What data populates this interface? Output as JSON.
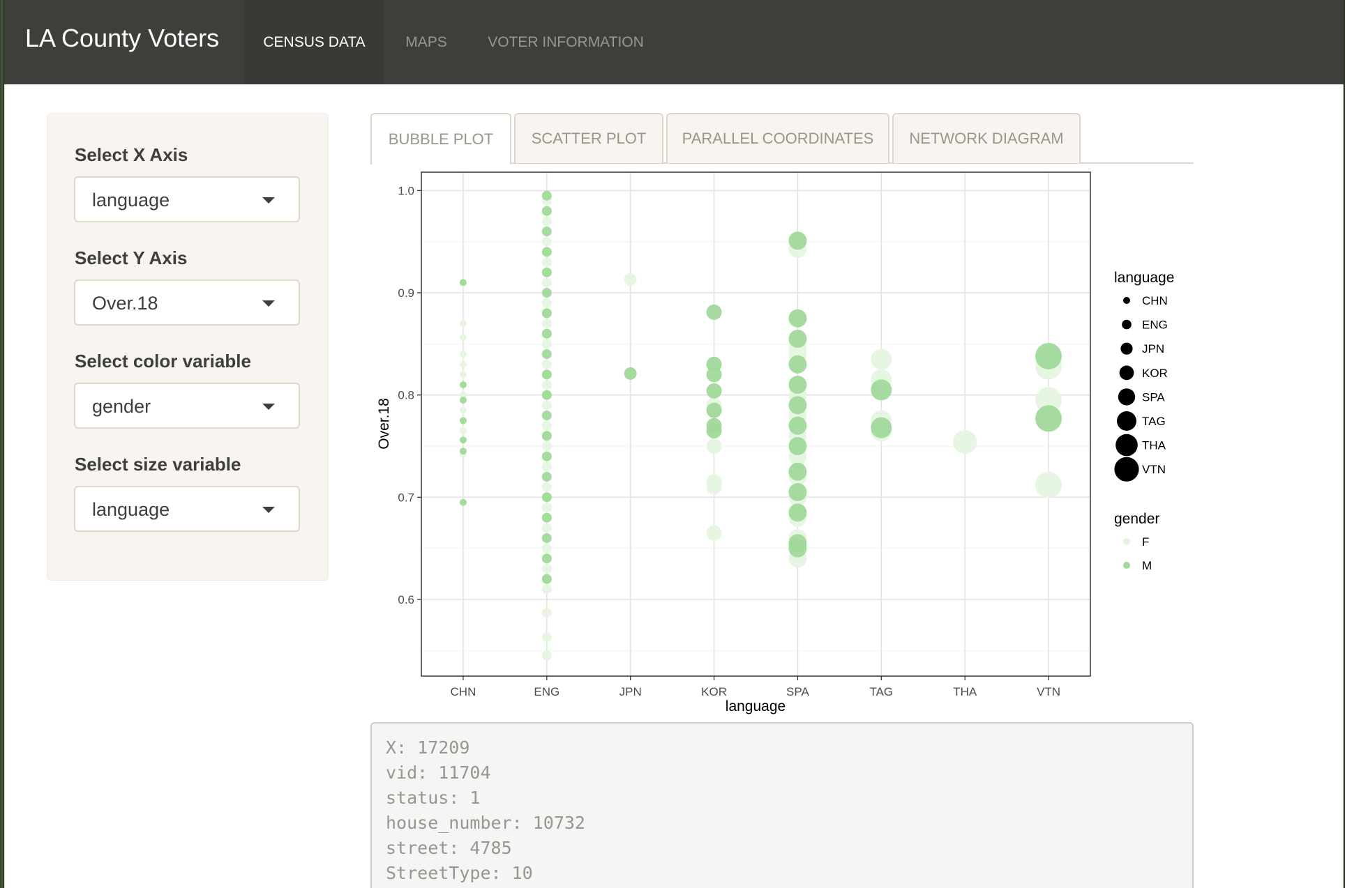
{
  "navbar": {
    "brand": "LA County Voters",
    "items": [
      {
        "label": "CENSUS DATA",
        "active": true
      },
      {
        "label": "MAPS",
        "active": false
      },
      {
        "label": "VOTER INFORMATION",
        "active": false
      }
    ]
  },
  "sidebar": {
    "fields": [
      {
        "label": "Select X Axis",
        "value": "language"
      },
      {
        "label": "Select Y Axis",
        "value": "Over.18"
      },
      {
        "label": "Select color variable",
        "value": "gender"
      },
      {
        "label": "Select size variable",
        "value": "language"
      }
    ]
  },
  "tabs": [
    {
      "label": "BUBBLE PLOT",
      "active": true
    },
    {
      "label": "SCATTER PLOT",
      "active": false
    },
    {
      "label": "PARALLEL COORDINATES",
      "active": false
    },
    {
      "label": "NETWORK DIAGRAM",
      "active": false
    }
  ],
  "chart_data": {
    "type": "scatter",
    "xlabel": "language",
    "ylabel": "Over.18",
    "categories": [
      "CHN",
      "ENG",
      "JPN",
      "KOR",
      "SPA",
      "TAG",
      "THA",
      "VTN"
    ],
    "ylim": [
      0.525,
      1.018
    ],
    "yticks": [
      0.6,
      0.7,
      0.8,
      0.9,
      1.0
    ],
    "ytick_labels": [
      "0.6",
      "0.7",
      "0.8",
      "0.9",
      "1.0"
    ],
    "grid": true,
    "colors": {
      "F": "#e5f5e0",
      "M": "#a1d99b"
    },
    "size_legend": {
      "title": "language",
      "entries": [
        "CHN",
        "ENG",
        "JPN",
        "KOR",
        "SPA",
        "TAG",
        "THA",
        "VTN"
      ]
    },
    "color_legend": {
      "title": "gender",
      "entries": [
        "F",
        "M"
      ]
    },
    "series": [
      {
        "name": "F",
        "points": [
          [
            "CHN",
            0.87
          ],
          [
            "CHN",
            0.856
          ],
          [
            "CHN",
            0.84
          ],
          [
            "CHN",
            0.83
          ],
          [
            "CHN",
            0.82
          ],
          [
            "CHN",
            0.8
          ],
          [
            "CHN",
            0.785
          ],
          [
            "CHN",
            0.765
          ],
          [
            "CHN",
            0.742
          ],
          [
            "ENG",
            0.99
          ],
          [
            "ENG",
            0.97
          ],
          [
            "ENG",
            0.95
          ],
          [
            "ENG",
            0.93
          ],
          [
            "ENG",
            0.91
          ],
          [
            "ENG",
            0.89
          ],
          [
            "ENG",
            0.87
          ],
          [
            "ENG",
            0.85
          ],
          [
            "ENG",
            0.83
          ],
          [
            "ENG",
            0.81
          ],
          [
            "ENG",
            0.79
          ],
          [
            "ENG",
            0.77
          ],
          [
            "ENG",
            0.75
          ],
          [
            "ENG",
            0.73
          ],
          [
            "ENG",
            0.71
          ],
          [
            "ENG",
            0.69
          ],
          [
            "ENG",
            0.67
          ],
          [
            "ENG",
            0.65
          ],
          [
            "ENG",
            0.63
          ],
          [
            "ENG",
            0.61
          ],
          [
            "ENG",
            0.587
          ],
          [
            "ENG",
            0.563
          ],
          [
            "ENG",
            0.545
          ],
          [
            "JPN",
            0.913
          ],
          [
            "KOR",
            0.79
          ],
          [
            "KOR",
            0.75
          ],
          [
            "KOR",
            0.715
          ],
          [
            "KOR",
            0.71
          ],
          [
            "KOR",
            0.665
          ],
          [
            "SPA",
            0.943
          ],
          [
            "SPA",
            0.845
          ],
          [
            "SPA",
            0.84
          ],
          [
            "SPA",
            0.8
          ],
          [
            "SPA",
            0.78
          ],
          [
            "SPA",
            0.76
          ],
          [
            "SPA",
            0.74
          ],
          [
            "SPA",
            0.72
          ],
          [
            "SPA",
            0.7
          ],
          [
            "SPA",
            0.68
          ],
          [
            "SPA",
            0.66
          ],
          [
            "SPA",
            0.64
          ],
          [
            "TAG",
            0.835
          ],
          [
            "TAG",
            0.815
          ],
          [
            "TAG",
            0.775
          ],
          [
            "TAG",
            0.765
          ],
          [
            "THA",
            0.754
          ],
          [
            "VTN",
            0.828
          ],
          [
            "VTN",
            0.795
          ],
          [
            "VTN",
            0.712
          ]
        ]
      },
      {
        "name": "M",
        "points": [
          [
            "CHN",
            0.91
          ],
          [
            "CHN",
            0.81
          ],
          [
            "CHN",
            0.795
          ],
          [
            "CHN",
            0.775
          ],
          [
            "CHN",
            0.756
          ],
          [
            "CHN",
            0.745
          ],
          [
            "CHN",
            0.695
          ],
          [
            "ENG",
            0.995
          ],
          [
            "ENG",
            0.98
          ],
          [
            "ENG",
            0.96
          ],
          [
            "ENG",
            0.94
          ],
          [
            "ENG",
            0.92
          ],
          [
            "ENG",
            0.9
          ],
          [
            "ENG",
            0.88
          ],
          [
            "ENG",
            0.86
          ],
          [
            "ENG",
            0.84
          ],
          [
            "ENG",
            0.82
          ],
          [
            "ENG",
            0.8
          ],
          [
            "ENG",
            0.78
          ],
          [
            "ENG",
            0.76
          ],
          [
            "ENG",
            0.74
          ],
          [
            "ENG",
            0.72
          ],
          [
            "ENG",
            0.7
          ],
          [
            "ENG",
            0.68
          ],
          [
            "ENG",
            0.66
          ],
          [
            "ENG",
            0.64
          ],
          [
            "ENG",
            0.62
          ],
          [
            "JPN",
            0.821
          ],
          [
            "KOR",
            0.881
          ],
          [
            "KOR",
            0.83
          ],
          [
            "KOR",
            0.82
          ],
          [
            "KOR",
            0.804
          ],
          [
            "KOR",
            0.785
          ],
          [
            "KOR",
            0.77
          ],
          [
            "KOR",
            0.765
          ],
          [
            "SPA",
            0.951
          ],
          [
            "SPA",
            0.875
          ],
          [
            "SPA",
            0.855
          ],
          [
            "SPA",
            0.83
          ],
          [
            "SPA",
            0.81
          ],
          [
            "SPA",
            0.79
          ],
          [
            "SPA",
            0.77
          ],
          [
            "SPA",
            0.75
          ],
          [
            "SPA",
            0.725
          ],
          [
            "SPA",
            0.705
          ],
          [
            "SPA",
            0.685
          ],
          [
            "SPA",
            0.655
          ],
          [
            "SPA",
            0.65
          ],
          [
            "TAG",
            0.805
          ],
          [
            "TAG",
            0.768
          ],
          [
            "VTN",
            0.838
          ],
          [
            "VTN",
            0.777
          ]
        ]
      }
    ]
  },
  "output": {
    "lines": [
      "X: 17209",
      "vid: 11704",
      "status: 1",
      "house_number: 10732",
      "street: 4785",
      "StreetType: 10"
    ]
  }
}
